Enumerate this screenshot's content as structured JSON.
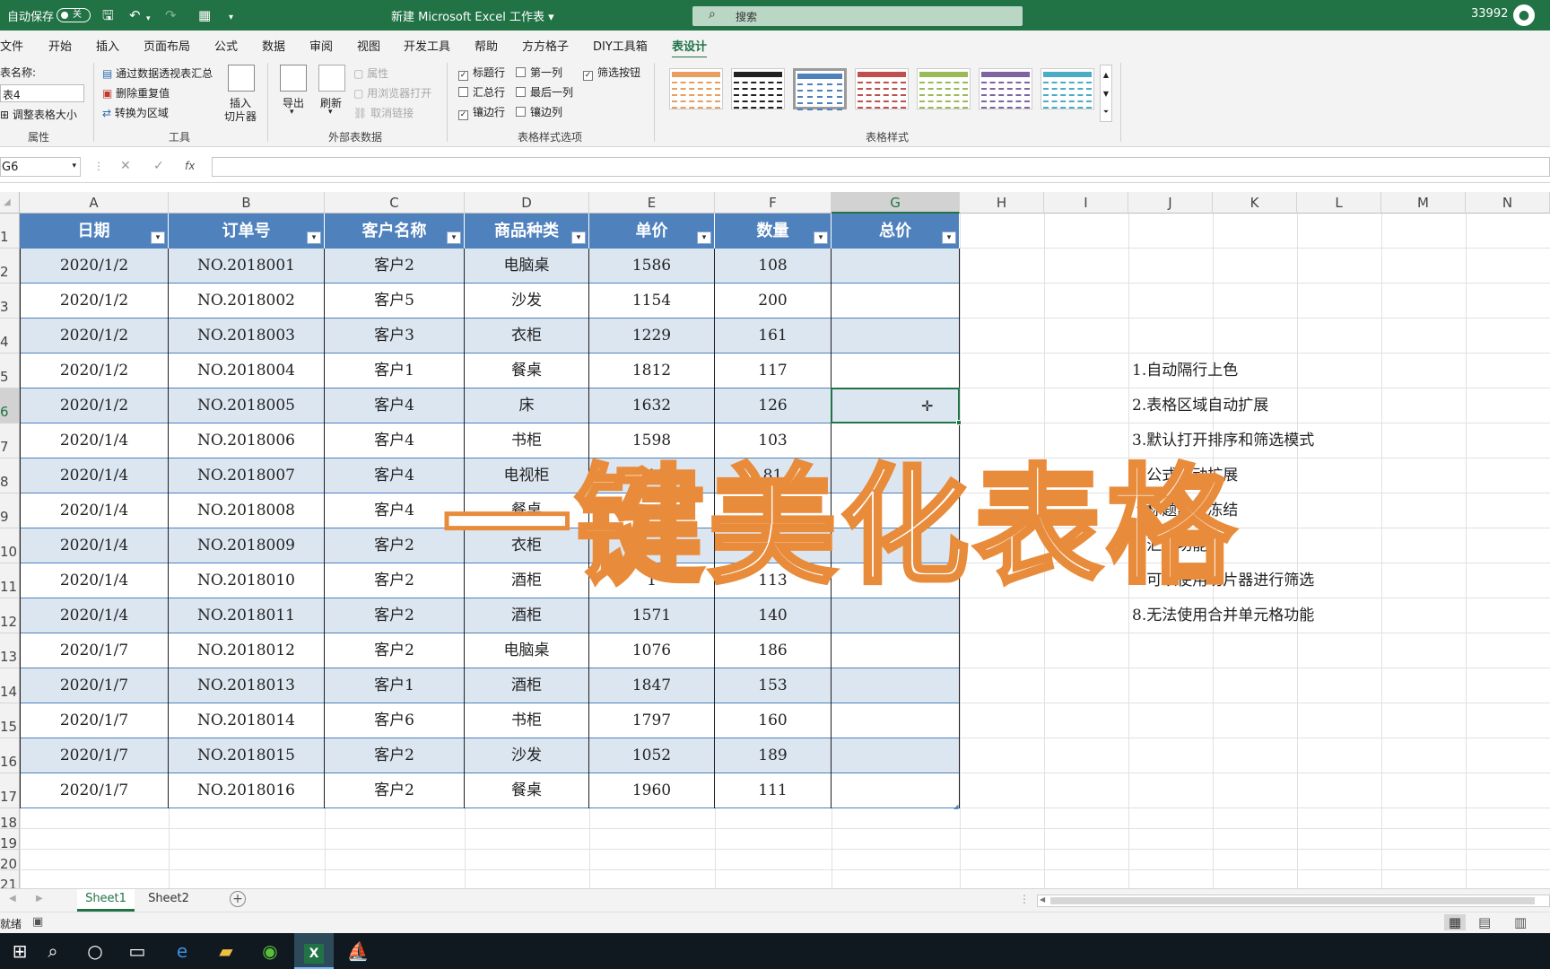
{
  "titlebar": {
    "autosave_label": "自动保存",
    "autosave_state": "关",
    "file_title": "新建 Microsoft Excel 工作表 ▾",
    "search_placeholder": "搜索",
    "user_id": "33992",
    "accent_color": "#217346"
  },
  "ribbon_tabs": [
    "文件",
    "开始",
    "插入",
    "页面布局",
    "公式",
    "数据",
    "审阅",
    "视图",
    "开发工具",
    "帮助",
    "方方格子",
    "DIY工具箱",
    "表设计"
  ],
  "active_tab": "表设计",
  "ribbon": {
    "properties": {
      "table_name_label": "表名称:",
      "table_name_value": "表4",
      "resize_label": "调整表格大小",
      "group_label": "属性"
    },
    "tools": {
      "pivot_label": "通过数据透视表汇总",
      "remove_dup_label": "删除重复值",
      "convert_label": "转换为区域",
      "slicer_label_1": "插入",
      "slicer_label_2": "切片器",
      "group_label": "工具"
    },
    "external": {
      "export_label": "导出",
      "refresh_label": "刷新",
      "properties_label": "属性",
      "browser_label": "用浏览器打开",
      "unlink_label": "取消链接",
      "group_label": "外部表数据"
    },
    "style_options": {
      "header_row": "标题行",
      "total_row": "汇总行",
      "banded_rows": "镶边行",
      "first_column": "第一列",
      "last_column": "最后一列",
      "banded_columns": "镶边列",
      "filter_button": "筛选按钮",
      "header_row_checked": "✓",
      "banded_rows_checked": "✓",
      "filter_button_checked": "✓",
      "group_label": "表格样式选项"
    },
    "table_styles": {
      "group_label": "表格样式",
      "swatch_colors": [
        "#e8a060",
        "#222222",
        "#4f81bd",
        "#c0504d",
        "#9bbb59",
        "#8064a2",
        "#4bacc6"
      ]
    }
  },
  "formula_bar": {
    "name_box": "G6",
    "cancel_icon": "✕",
    "enter_icon": "✓",
    "fx_label": "fx",
    "content": ""
  },
  "grid": {
    "column_letters": [
      "A",
      "B",
      "C",
      "D",
      "E",
      "F",
      "G",
      "H",
      "I",
      "J",
      "K",
      "L",
      "M",
      "N"
    ],
    "selected_column": "G",
    "row_numbers": [
      "1",
      "2",
      "3",
      "4",
      "5",
      "6",
      "7",
      "8",
      "9",
      "10",
      "11",
      "12",
      "13",
      "14",
      "15",
      "16",
      "17",
      "18",
      "19",
      "20",
      "21"
    ],
    "selected_row": "6",
    "table_header_color": "#4f81bd",
    "band_color": "#dce6f1"
  },
  "table": {
    "headers": [
      "日期",
      "订单号",
      "客户名称",
      "商品种类",
      "单价",
      "数量",
      "总价"
    ],
    "rows": [
      [
        "2020/1/2",
        "NO.2018001",
        "客户2",
        "电脑桌",
        "1586",
        "108",
        ""
      ],
      [
        "2020/1/2",
        "NO.2018002",
        "客户5",
        "沙发",
        "1154",
        "200",
        ""
      ],
      [
        "2020/1/2",
        "NO.2018003",
        "客户3",
        "衣柜",
        "1229",
        "161",
        ""
      ],
      [
        "2020/1/2",
        "NO.2018004",
        "客户1",
        "餐桌",
        "1812",
        "117",
        ""
      ],
      [
        "2020/1/2",
        "NO.2018005",
        "客户4",
        "床",
        "1632",
        "126",
        ""
      ],
      [
        "2020/1/4",
        "NO.2018006",
        "客户4",
        "书柜",
        "1598",
        "103",
        ""
      ],
      [
        "2020/1/4",
        "NO.2018007",
        "客户4",
        "电视柜",
        "116",
        "81",
        ""
      ],
      [
        "2020/1/4",
        "NO.2018008",
        "客户4",
        "餐桌",
        "",
        "",
        ""
      ],
      [
        "2020/1/4",
        "NO.2018009",
        "客户2",
        "衣柜",
        "",
        "",
        ""
      ],
      [
        "2020/1/4",
        "NO.2018010",
        "客户2",
        "酒柜",
        "1",
        "113",
        ""
      ],
      [
        "2020/1/4",
        "NO.2018011",
        "客户2",
        "酒柜",
        "1571",
        "140",
        ""
      ],
      [
        "2020/1/7",
        "NO.2018012",
        "客户2",
        "电脑桌",
        "1076",
        "186",
        ""
      ],
      [
        "2020/1/7",
        "NO.2018013",
        "客户1",
        "酒柜",
        "1847",
        "153",
        ""
      ],
      [
        "2020/1/7",
        "NO.2018014",
        "客户6",
        "书柜",
        "1797",
        "160",
        ""
      ],
      [
        "2020/1/7",
        "NO.2018015",
        "客户2",
        "沙发",
        "1052",
        "189",
        ""
      ],
      [
        "2020/1/7",
        "NO.2018016",
        "客户2",
        "餐桌",
        "1960",
        "111",
        ""
      ]
    ]
  },
  "notes": [
    "1.自动隔行上色",
    "2.表格区域自动扩展",
    "3.默认打开排序和筛选模式",
    "4.公式自动扩展",
    "5.标题默认冻结",
    "6.汇总功能",
    "7.可以使用切片器进行筛选",
    "8.无法使用合并单元格功能"
  ],
  "overlay_title": "一键美化表格",
  "overlay_color": "#e88c3c",
  "sheets": [
    "Sheet1",
    "Sheet2"
  ],
  "active_sheet": "Sheet1",
  "status": {
    "ready": "就绪"
  },
  "taskbar_icons": [
    "windows-icon",
    "search-icon",
    "cortana-icon",
    "task-view-icon",
    "edge-icon",
    "explorer-icon",
    "browser-icon",
    "excel-icon",
    "app-icon"
  ]
}
